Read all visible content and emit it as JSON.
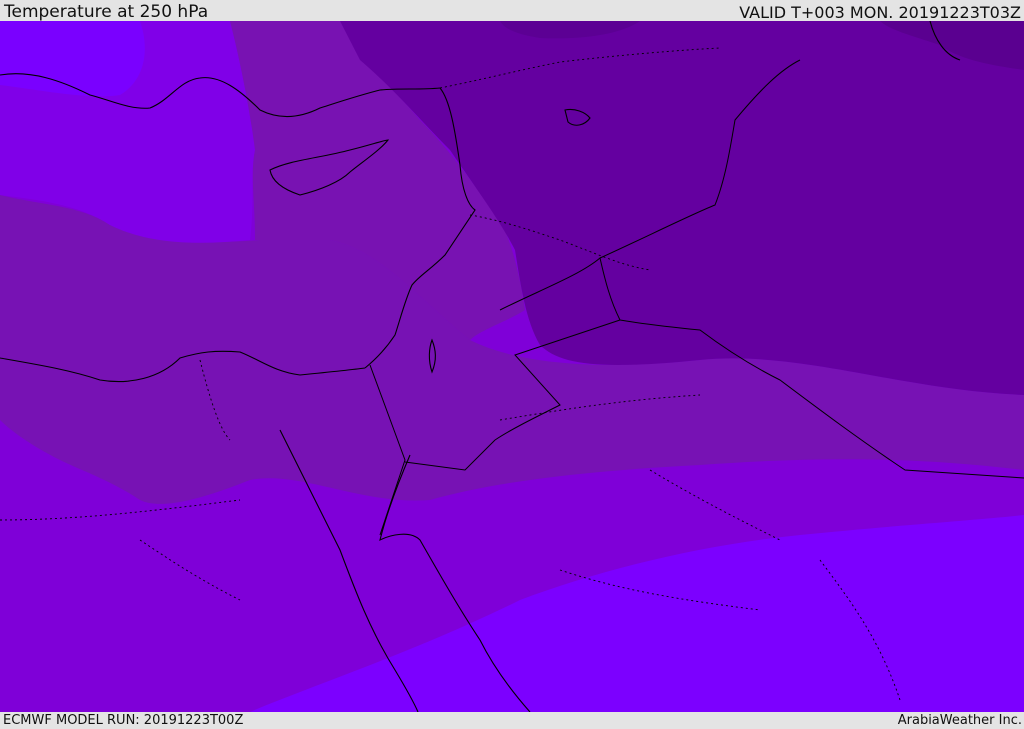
{
  "header": {
    "title": "Temperature at 250 hPa",
    "valid": "VALID T+003 MON. 20191223T03Z"
  },
  "footer": {
    "model_run": "ECMWF MODEL RUN: 20191223T00Z",
    "brand": "ArabiaWeather Inc."
  },
  "map": {
    "region": "Eastern Mediterranean / Middle East",
    "colors": {
      "coldest": "#5f0090",
      "cold": "#6a00a0",
      "mid": "#7a10b0",
      "warm": "#8000dc",
      "warmest": "#7f00ff",
      "coast_line": "#000000"
    }
  }
}
